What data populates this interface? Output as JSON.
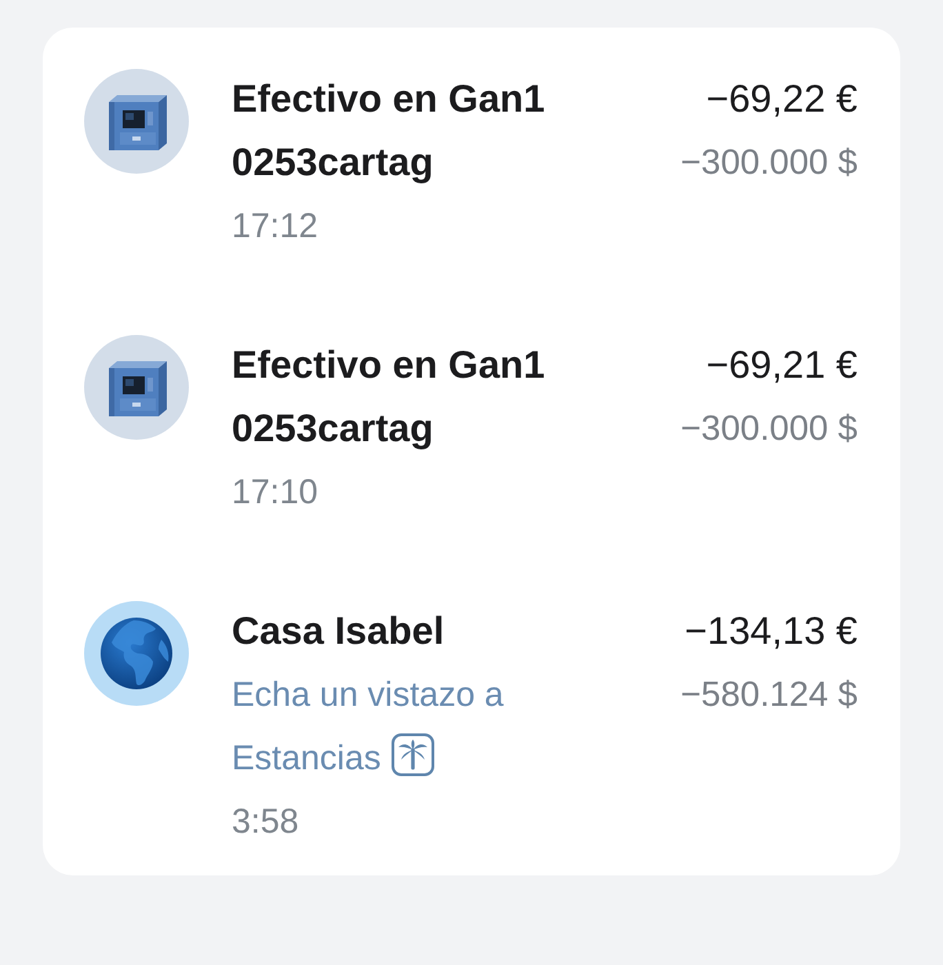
{
  "transactions": [
    {
      "kind": "atm",
      "title": "Efectivo en Gan1 0253cartag",
      "amount": "−69,22 €",
      "converted_amount": "−300.000 $",
      "time": "17:12"
    },
    {
      "kind": "atm",
      "title": "Efectivo en Gan1 0253cartag",
      "amount": "−69,21 €",
      "converted_amount": "−300.000 $",
      "time": "17:10"
    },
    {
      "kind": "globe",
      "title": "Casa Isabel",
      "note": "Echa un vistazo a Estancias",
      "amount": "−134,13 €",
      "converted_amount": "−580.124 $",
      "time": "3:58"
    }
  ]
}
